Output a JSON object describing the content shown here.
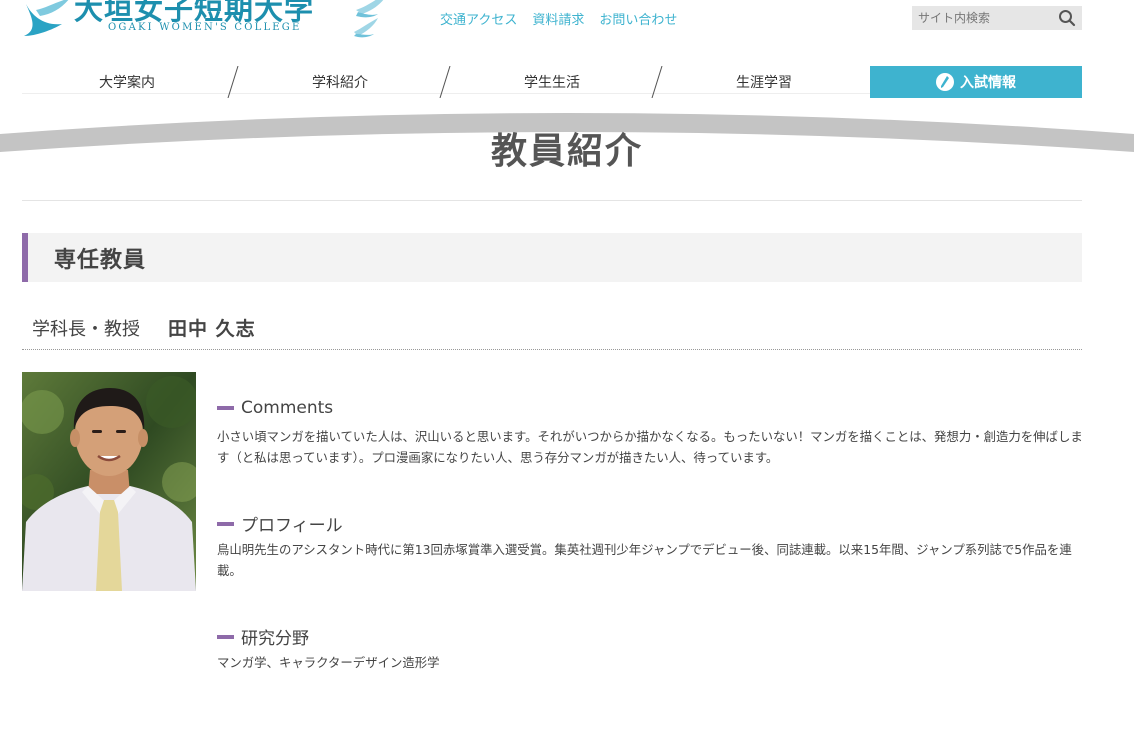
{
  "header": {
    "logo_jp": "大垣女子短期大学",
    "logo_en": "OGAKI WOMEN'S COLLEGE",
    "util_links": [
      "交通アクセス",
      "資料請求",
      "お問い合わせ"
    ],
    "search_placeholder": "サイト内検索"
  },
  "nav": {
    "items": [
      "大学案内",
      "学科紹介",
      "学生生活",
      "生涯学習"
    ],
    "exam_label": "入試情報"
  },
  "page": {
    "title": "教員紹介",
    "section": "専任教員"
  },
  "teacher": {
    "position": "学科長・教授",
    "name": "田中 久志",
    "blocks": [
      {
        "heading": "Comments",
        "text": "小さい頃マンガを描いていた人は、沢山いると思います。それがいつからか描かなくなる。もったいない！マンガを描くことは、発想力・創造力を伸ばします（と私は思っています）。プロ漫画家になりたい人、思う存分マンガが描きたい人、待っています。"
      },
      {
        "heading": "プロフィール",
        "text": "鳥山明先生のアシスタント時代に第13回赤塚賞準入選受賞。集英社週刊少年ジャンプでデビュー後、同誌連載。以来15年間、ジャンプ系列誌で5作品を連載。"
      },
      {
        "heading": "研究分野",
        "text": "マンガ学、キャラクターデザイン造形学"
      }
    ]
  },
  "colors": {
    "brand": "#1d8fae",
    "accent": "#3eb3cf",
    "section_bar": "#8e6aa9"
  }
}
